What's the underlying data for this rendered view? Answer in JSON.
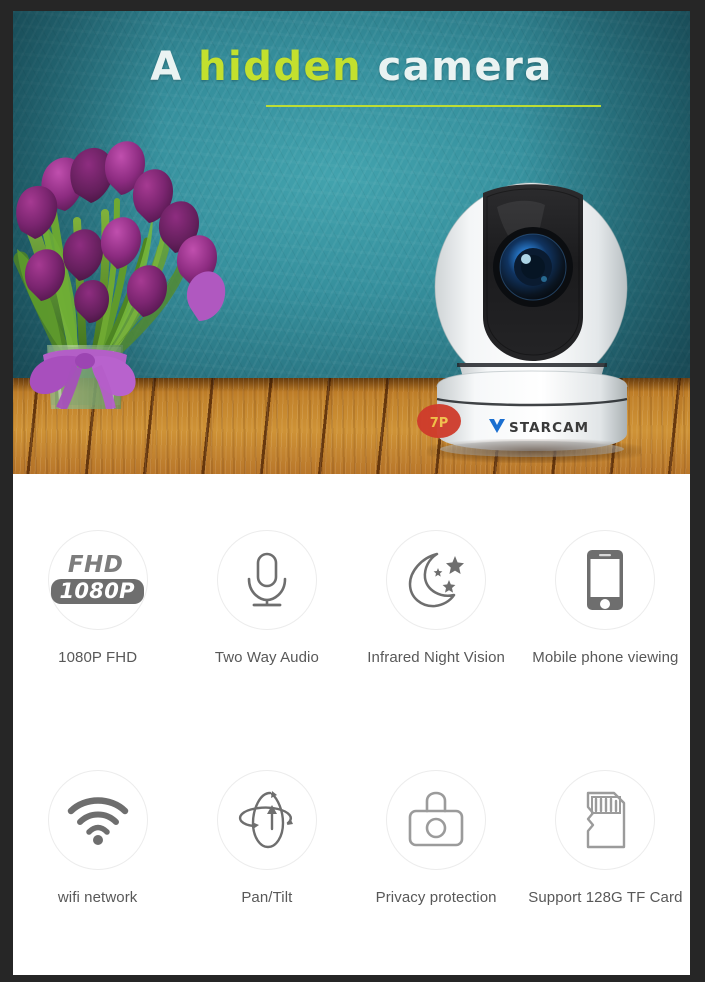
{
  "hero": {
    "headline": {
      "part1": "A ",
      "part2": "hidden",
      "part3": " camera",
      "accent_color": "#c3e02e",
      "white_color": "#eaf3f2"
    },
    "scene": {
      "wall_color": "#36909d",
      "floor_color": "#c2832c",
      "flowers_alt": "purple-tulips-in-glass-vase",
      "ribbon_color": "#a74fbe"
    },
    "product": {
      "brand_logo": "VSTARCAM",
      "brand_v_color": "#1a6fd0",
      "brand_text_color": "#3a3a3a",
      "body_color": "#f7f8f8",
      "lens_color": "#2b66a8",
      "sticker_color": "#cf3b2b"
    }
  },
  "features": {
    "rows": [
      {
        "items": [
          {
            "icon": "fhd-1080p-icon",
            "label": "1080P FHD",
            "badge_top": "FHD",
            "badge_bottom": "1080P"
          },
          {
            "icon": "microphone-icon",
            "label": "Two Way Audio"
          },
          {
            "icon": "moon-stars-icon",
            "label": "Infrared Night Vision"
          },
          {
            "icon": "smartphone-icon",
            "label": "Mobile phone viewing"
          }
        ]
      },
      {
        "items": [
          {
            "icon": "wifi-icon",
            "label": "wifi network"
          },
          {
            "icon": "pan-tilt-icon",
            "label": "Pan/Tilt"
          },
          {
            "icon": "camera-privacy-icon",
            "label": "Privacy protection"
          },
          {
            "icon": "tf-card-icon",
            "label": "Support 128G TF Card"
          }
        ]
      }
    ],
    "icon_stroke_color": "#6e6e6e",
    "circle_border_color": "#ececec",
    "label_color": "#585858"
  }
}
